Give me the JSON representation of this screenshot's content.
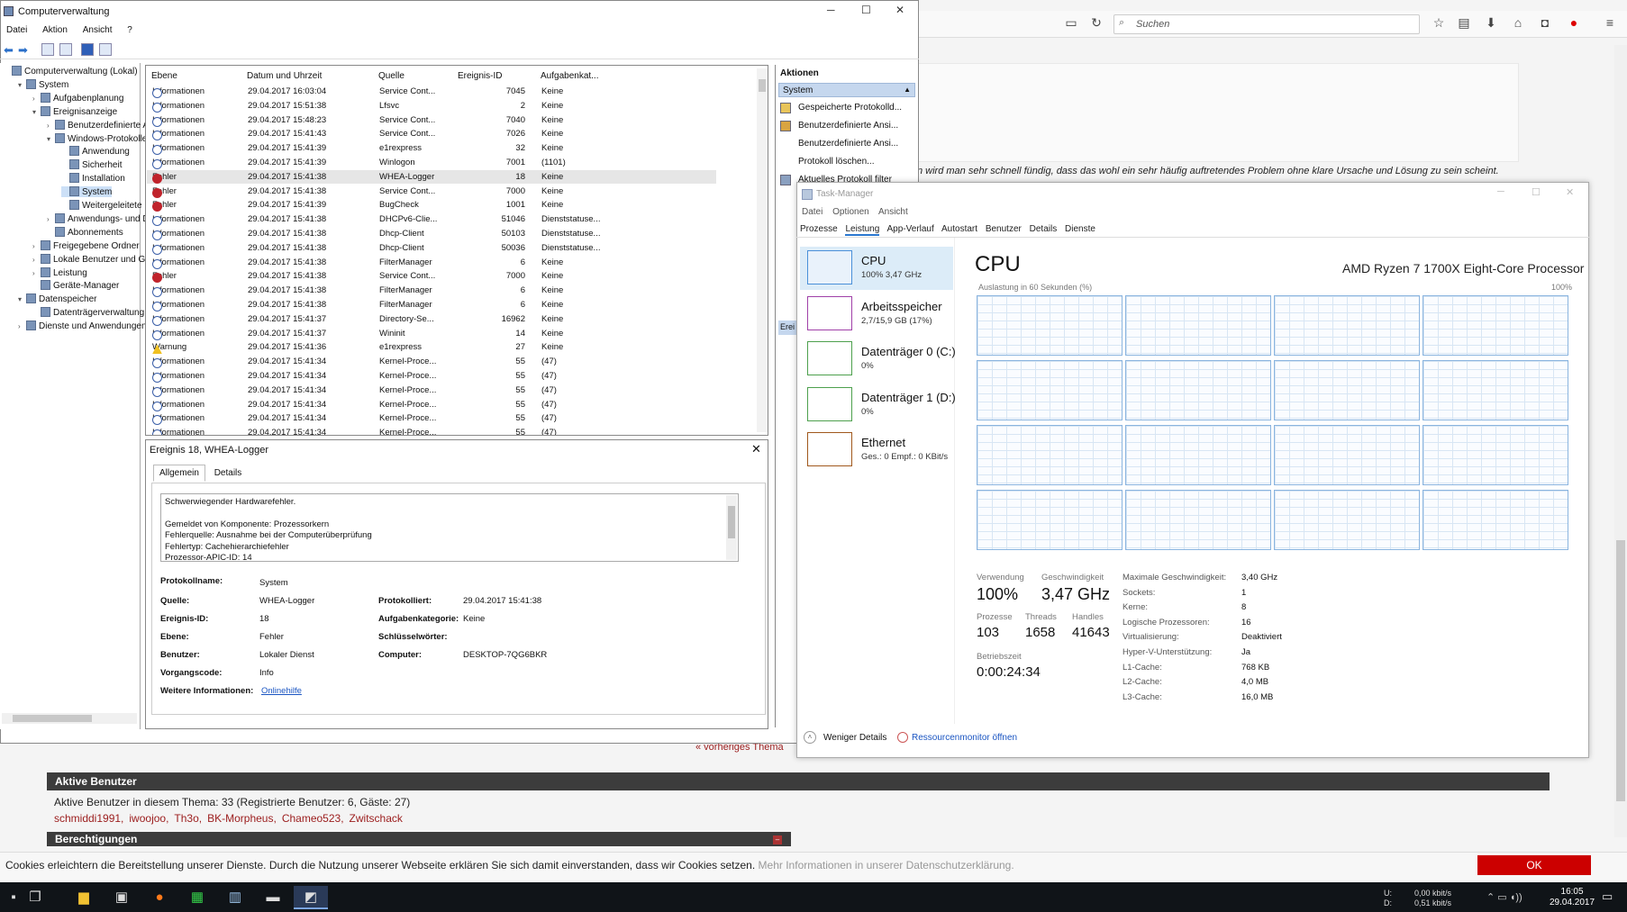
{
  "browser": {
    "search_placeholder": "Suchen",
    "forum_text": "n wird man sehr schnell fündig, dass das wohl ein sehr häufig auftretendes Problem ohne klare Ursache und Lösung zu sein scheint.",
    "prev_topic": "« vorheriges Thema",
    "active_users_title": "Aktive Benutzer",
    "active_users_text": "Aktive Benutzer in diesem Thema: 33 (Registrierte Benutzer: 6, Gäste: 27)",
    "users": [
      "schmiddi1991,",
      "iwoojoo,",
      "Th3o,",
      "BK-Morpheus,",
      "Chameo523,",
      "Zwitschack"
    ],
    "permissions_title": "Berechtigungen",
    "cookie_text": "Cookies erleichtern die Bereitstellung unserer Dienste. Durch die Nutzung unserer Webseite erklären Sie sich damit einverstanden, dass wir Cookies setzen.",
    "cookie_more": "Mehr Informationen in unserer Datenschutzerklärung.",
    "cookie_ok": "OK"
  },
  "taskbar": {
    "net_up": "0,00 kbit/s",
    "net_down": "0,51 kbit/s",
    "net_u": "U:",
    "net_d": "D:",
    "time": "16:05",
    "date": "29.04.2017"
  },
  "mmc": {
    "title": "Computerverwaltung",
    "menu": [
      "Datei",
      "Aktion",
      "Ansicht",
      "?"
    ],
    "tree": [
      {
        "label": "Computerverwaltung (Lokal)",
        "indent": 0,
        "exp": ""
      },
      {
        "label": "System",
        "indent": 1,
        "exp": "▾"
      },
      {
        "label": "Aufgabenplanung",
        "indent": 2,
        "exp": "›"
      },
      {
        "label": "Ereignisanzeige",
        "indent": 2,
        "exp": "▾"
      },
      {
        "label": "Benutzerdefinierte A",
        "indent": 3,
        "exp": "›"
      },
      {
        "label": "Windows-Protokolle",
        "indent": 3,
        "exp": "▾"
      },
      {
        "label": "Anwendung",
        "indent": 4,
        "exp": ""
      },
      {
        "label": "Sicherheit",
        "indent": 4,
        "exp": ""
      },
      {
        "label": "Installation",
        "indent": 4,
        "exp": ""
      },
      {
        "label": "System",
        "indent": 4,
        "exp": "",
        "selected": true
      },
      {
        "label": "Weitergeleitete E",
        "indent": 4,
        "exp": ""
      },
      {
        "label": "Anwendungs- und D",
        "indent": 3,
        "exp": "›"
      },
      {
        "label": "Abonnements",
        "indent": 3,
        "exp": ""
      },
      {
        "label": "Freigegebene Ordner",
        "indent": 2,
        "exp": "›"
      },
      {
        "label": "Lokale Benutzer und Gr",
        "indent": 2,
        "exp": "›"
      },
      {
        "label": "Leistung",
        "indent": 2,
        "exp": "›"
      },
      {
        "label": "Geräte-Manager",
        "indent": 2,
        "exp": ""
      },
      {
        "label": "Datenspeicher",
        "indent": 1,
        "exp": "▾"
      },
      {
        "label": "Datenträgerverwaltung",
        "indent": 2,
        "exp": ""
      },
      {
        "label": "Dienste und Anwendungen",
        "indent": 1,
        "exp": "›"
      }
    ],
    "columns": [
      "Ebene",
      "Datum und Uhrzeit",
      "Quelle",
      "Ereignis-ID",
      "Aufgabenkat..."
    ],
    "events": [
      {
        "level": "Informationen",
        "type": "info",
        "date": "29.04.2017 16:03:04",
        "source": "Service Cont...",
        "id": "7045",
        "cat": "Keine"
      },
      {
        "level": "Informationen",
        "type": "info",
        "date": "29.04.2017 15:51:38",
        "source": "Lfsvc",
        "id": "2",
        "cat": "Keine"
      },
      {
        "level": "Informationen",
        "type": "info",
        "date": "29.04.2017 15:48:23",
        "source": "Service Cont...",
        "id": "7040",
        "cat": "Keine"
      },
      {
        "level": "Informationen",
        "type": "info",
        "date": "29.04.2017 15:41:43",
        "source": "Service Cont...",
        "id": "7026",
        "cat": "Keine"
      },
      {
        "level": "Informationen",
        "type": "info",
        "date": "29.04.2017 15:41:39",
        "source": "e1rexpress",
        "id": "32",
        "cat": "Keine"
      },
      {
        "level": "Informationen",
        "type": "info",
        "date": "29.04.2017 15:41:39",
        "source": "Winlogon",
        "id": "7001",
        "cat": "(1101)"
      },
      {
        "level": "Fehler",
        "type": "err",
        "date": "29.04.2017 15:41:38",
        "source": "WHEA-Logger",
        "id": "18",
        "cat": "Keine",
        "selected": true
      },
      {
        "level": "Fehler",
        "type": "err",
        "date": "29.04.2017 15:41:38",
        "source": "Service Cont...",
        "id": "7000",
        "cat": "Keine"
      },
      {
        "level": "Fehler",
        "type": "err",
        "date": "29.04.2017 15:41:39",
        "source": "BugCheck",
        "id": "1001",
        "cat": "Keine"
      },
      {
        "level": "Informationen",
        "type": "info",
        "date": "29.04.2017 15:41:38",
        "source": "DHCPv6-Clie...",
        "id": "51046",
        "cat": "Dienststatuse..."
      },
      {
        "level": "Informationen",
        "type": "info",
        "date": "29.04.2017 15:41:38",
        "source": "Dhcp-Client",
        "id": "50103",
        "cat": "Dienststatuse..."
      },
      {
        "level": "Informationen",
        "type": "info",
        "date": "29.04.2017 15:41:38",
        "source": "Dhcp-Client",
        "id": "50036",
        "cat": "Dienststatuse..."
      },
      {
        "level": "Informationen",
        "type": "info",
        "date": "29.04.2017 15:41:38",
        "source": "FilterManager",
        "id": "6",
        "cat": "Keine"
      },
      {
        "level": "Fehler",
        "type": "err",
        "date": "29.04.2017 15:41:38",
        "source": "Service Cont...",
        "id": "7000",
        "cat": "Keine"
      },
      {
        "level": "Informationen",
        "type": "info",
        "date": "29.04.2017 15:41:38",
        "source": "FilterManager",
        "id": "6",
        "cat": "Keine"
      },
      {
        "level": "Informationen",
        "type": "info",
        "date": "29.04.2017 15:41:38",
        "source": "FilterManager",
        "id": "6",
        "cat": "Keine"
      },
      {
        "level": "Informationen",
        "type": "info",
        "date": "29.04.2017 15:41:37",
        "source": "Directory-Se...",
        "id": "16962",
        "cat": "Keine"
      },
      {
        "level": "Informationen",
        "type": "info",
        "date": "29.04.2017 15:41:37",
        "source": "Wininit",
        "id": "14",
        "cat": "Keine"
      },
      {
        "level": "Warnung",
        "type": "warn",
        "date": "29.04.2017 15:41:36",
        "source": "e1rexpress",
        "id": "27",
        "cat": "Keine"
      },
      {
        "level": "Informationen",
        "type": "info",
        "date": "29.04.2017 15:41:34",
        "source": "Kernel-Proce...",
        "id": "55",
        "cat": "(47)"
      },
      {
        "level": "Informationen",
        "type": "info",
        "date": "29.04.2017 15:41:34",
        "source": "Kernel-Proce...",
        "id": "55",
        "cat": "(47)"
      },
      {
        "level": "Informationen",
        "type": "info",
        "date": "29.04.2017 15:41:34",
        "source": "Kernel-Proce...",
        "id": "55",
        "cat": "(47)"
      },
      {
        "level": "Informationen",
        "type": "info",
        "date": "29.04.2017 15:41:34",
        "source": "Kernel-Proce...",
        "id": "55",
        "cat": "(47)"
      },
      {
        "level": "Informationen",
        "type": "info",
        "date": "29.04.2017 15:41:34",
        "source": "Kernel-Proce...",
        "id": "55",
        "cat": "(47)"
      },
      {
        "level": "Informationen",
        "type": "info",
        "date": "29.04.2017 15:41:34",
        "source": "Kernel-Proce...",
        "id": "55",
        "cat": "(47)"
      }
    ],
    "detail": {
      "title": "Ereignis 18, WHEA-Logger",
      "tab_general": "Allgemein",
      "tab_details": "Details",
      "text_lines": [
        "Schwerwiegender Hardwarefehler.",
        "",
        "Gemeldet von Komponente: Prozessorkern",
        "Fehlerquelle: Ausnahme bei der Computerüberprüfung",
        "Fehlertyp: Cachehierarchiefehler",
        "Prozessor-APIC-ID: 14"
      ],
      "log_name_k": "Protokollname:",
      "log_name_v": "System",
      "source_k": "Quelle:",
      "source_v": "WHEA-Logger",
      "logged_k": "Protokolliert:",
      "logged_v": "29.04.2017 15:41:38",
      "eventid_k": "Ereignis-ID:",
      "eventid_v": "18",
      "taskcat_k": "Aufgabenkategorie:",
      "taskcat_v": "Keine",
      "level_k": "Ebene:",
      "level_v": "Fehler",
      "keywords_k": "Schlüsselwörter:",
      "keywords_v": "",
      "user_k": "Benutzer:",
      "user_v": "Lokaler Dienst",
      "computer_k": "Computer:",
      "computer_v": "DESKTOP-7QG6BKR",
      "opcode_k": "Vorgangscode:",
      "opcode_v": "Info",
      "more_k": "Weitere Informationen:",
      "more_v": "Onlinehilfe"
    },
    "actions": {
      "title": "Aktionen",
      "section": "System",
      "items": [
        "Gespeicherte Protokolld...",
        "Benutzerdefinierte Ansi...",
        "Benutzerdefinierte Ansi...",
        "Protokoll löschen...",
        "Aktuelles Protokoll filter..."
      ],
      "section2": "Erei"
    }
  },
  "taskmgr": {
    "title": "Task-Manager",
    "menu": [
      "Datei",
      "Optionen",
      "Ansicht"
    ],
    "tabs": [
      "Prozesse",
      "Leistung",
      "App-Verlauf",
      "Autostart",
      "Benutzer",
      "Details",
      "Dienste"
    ],
    "active_tab": 1,
    "resources": [
      {
        "name": "CPU",
        "sub": "100%  3,47 GHz",
        "color": "#4a90d9"
      },
      {
        "name": "Arbeitsspeicher",
        "sub": "2,7/15,9 GB (17%)",
        "color": "#a040a8"
      },
      {
        "name": "Datenträger 0 (C:)",
        "sub": "0%",
        "color": "#4da04d"
      },
      {
        "name": "Datenträger 1 (D:)",
        "sub": "0%",
        "color": "#4da04d"
      },
      {
        "name": "Ethernet",
        "sub": "Ges.: 0  Empf.: 0 KBit/s",
        "color": "#a0581c"
      }
    ],
    "cpu_title": "CPU",
    "cpu_model": "AMD Ryzen 7 1700X Eight-Core Processor",
    "util_label": "Auslastung in 60 Sekunden (%)",
    "util_max": "100%",
    "cores": 16,
    "stats": {
      "usage_l": "Verwendung",
      "usage_v": "100%",
      "speed_l": "Geschwindigkeit",
      "speed_v": "3,47 GHz",
      "proc_l": "Prozesse",
      "proc_v": "103",
      "threads_l": "Threads",
      "threads_v": "1658",
      "handles_l": "Handles",
      "handles_v": "41643",
      "uptime_l": "Betriebszeit",
      "uptime_v": "0:00:24:34"
    },
    "specs": [
      {
        "k": "Maximale Geschwindigkeit:",
        "v": "3,40 GHz"
      },
      {
        "k": "Sockets:",
        "v": "1"
      },
      {
        "k": "Kerne:",
        "v": "8"
      },
      {
        "k": "Logische Prozessoren:",
        "v": "16"
      },
      {
        "k": "Virtualisierung:",
        "v": "Deaktiviert"
      },
      {
        "k": "Hyper-V-Unterstützung:",
        "v": "Ja"
      },
      {
        "k": "L1-Cache:",
        "v": "768 KB"
      },
      {
        "k": "L2-Cache:",
        "v": "4,0 MB"
      },
      {
        "k": "L3-Cache:",
        "v": "16,0 MB"
      }
    ],
    "fewer_details": "Weniger Details",
    "resmon": "Ressourcenmonitor öffnen"
  }
}
